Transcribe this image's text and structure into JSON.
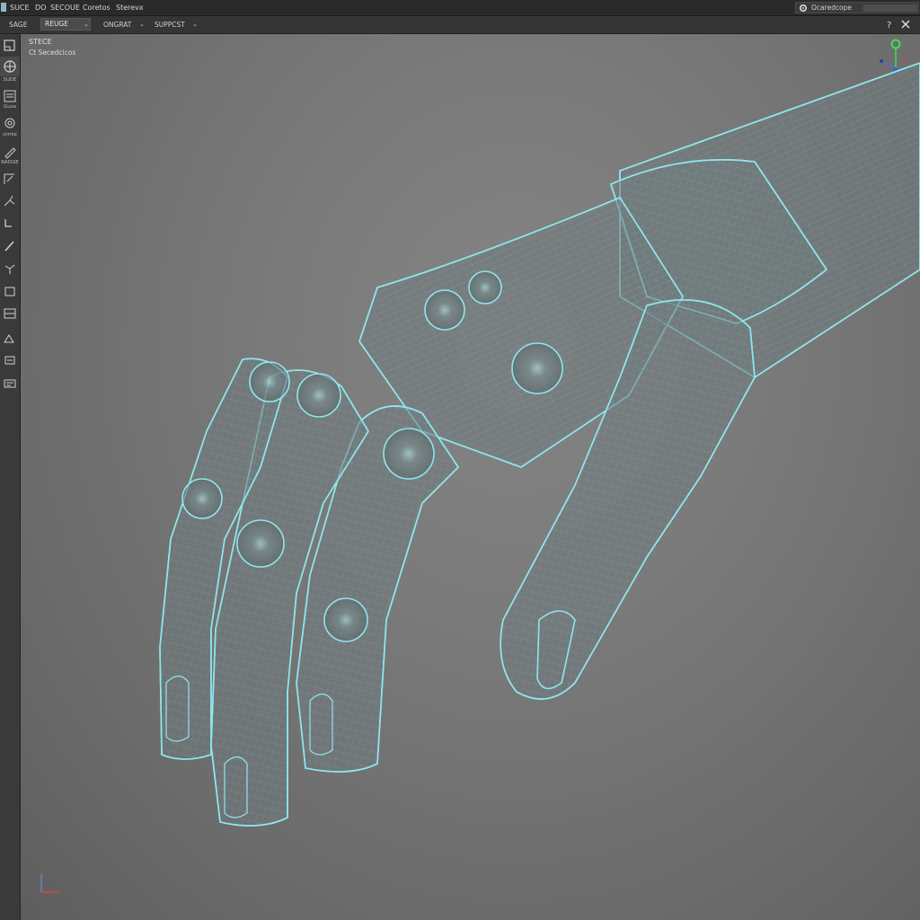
{
  "menubar": {
    "items": [
      "SUCE",
      "DO",
      "SECOUE",
      "Coretos",
      "Sterevx"
    ],
    "search_placeholder": "Ocaredcope"
  },
  "toolbar": {
    "first_label": "SAGE",
    "select_value": "REUGE",
    "item_2": "ONGRAT",
    "item_3": "SUPPCST"
  },
  "leftpanel": {
    "labels": [
      "SUDE",
      "Gusa",
      "ormie",
      "RAISSE"
    ]
  },
  "viewport": {
    "title": "STECE",
    "subtitle": "Ct Secedcicos"
  },
  "colors": {
    "wire": "#8fe6ee",
    "accent_green": "#3fdc5a",
    "axis_red": "#e04040"
  },
  "icons": [
    "app-icon",
    "gear-icon",
    "help-icon",
    "close-icon",
    "chevron-down-icon"
  ]
}
